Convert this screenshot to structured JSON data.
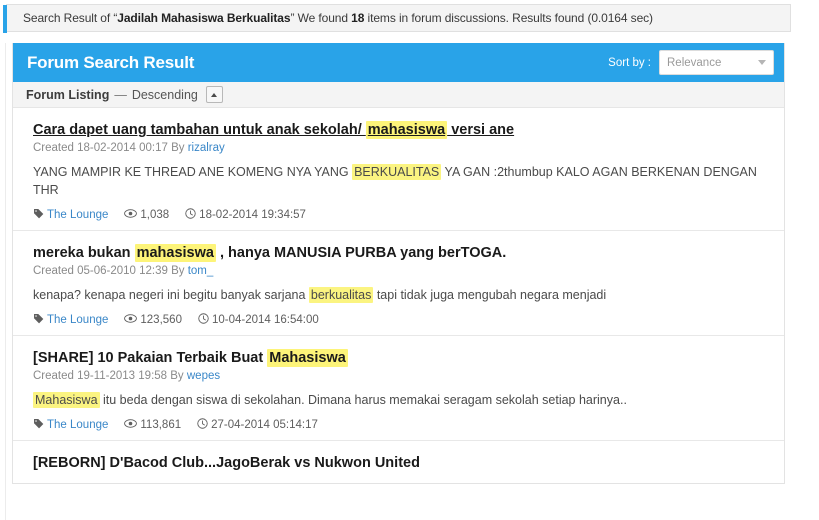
{
  "alert": {
    "prefix": "Search Result of “",
    "query": "Jadilah Mahasiswa Berkualitas",
    "mid": "” We found ",
    "count": "18",
    "suffix": " items in forum discussions. Results found (0.0164 sec)"
  },
  "panel": {
    "title": "Forum Search Result",
    "sort_label": "Sort by :",
    "sort_value": "Relevance",
    "sort_options": [
      "Relevance"
    ],
    "listing_label": "Forum Listing",
    "listing_dash": "—",
    "listing_order": "Descending",
    "collapse_icon": "chevron-up-icon"
  },
  "colors": {
    "accent_blue": "#29a3e8",
    "link_blue": "#3a87c8",
    "highlight_yellow": "#fbf481",
    "panel_bg": "#ffffff",
    "subheader_bg": "#f4f4f4"
  },
  "icons": {
    "tag": "tag-icon",
    "views": "eye-icon",
    "time": "clock-icon",
    "caret_down": "chevron-down-icon"
  },
  "results": [
    {
      "title_parts": [
        {
          "t": "Cara dapet uang tambahan untuk anak sekolah/ ",
          "hl": false
        },
        {
          "t": "mahasiswa",
          "hl": true
        },
        {
          "t": " versi ane",
          "hl": false
        }
      ],
      "title_plain": "Cara dapet uang tambahan untuk anak sekolah/ mahasiswa versi ane",
      "hovered": true,
      "created_prefix": "Created 18-02-2014 00:17 By ",
      "author": "rizalray",
      "snippet_parts": [
        {
          "t": "YANG MAMPIR KE THREAD ANE KOMENG NYA YANG ",
          "hl": false
        },
        {
          "t": "BERKUALITAS",
          "hl": true
        },
        {
          "t": " YA GAN :2thumbup KALO AGAN BERKENAN DENGAN THR",
          "hl": false
        }
      ],
      "forum": "The Lounge",
      "views": "1,038",
      "time": "18-02-2014 19:34:57"
    },
    {
      "title_parts": [
        {
          "t": "mereka bukan ",
          "hl": false
        },
        {
          "t": "mahasiswa",
          "hl": true
        },
        {
          "t": " , hanya MANUSIA PURBA yang berTOGA.",
          "hl": false
        }
      ],
      "title_plain": "mereka bukan mahasiswa , hanya MANUSIA PURBA yang berTOGA.",
      "hovered": false,
      "created_prefix": "Created 05-06-2010 12:39 By ",
      "author": "tom_",
      "snippet_parts": [
        {
          "t": "kenapa? kenapa negeri ini begitu banyak sarjana ",
          "hl": false
        },
        {
          "t": "berkualitas",
          "hl": true
        },
        {
          "t": " tapi tidak juga mengubah negara menjadi",
          "hl": false
        }
      ],
      "forum": "The Lounge",
      "views": "123,560",
      "time": "10-04-2014 16:54:00"
    },
    {
      "title_parts": [
        {
          "t": "[SHARE] 10 Pakaian Terbaik Buat ",
          "hl": false
        },
        {
          "t": "Mahasiswa",
          "hl": true
        }
      ],
      "title_plain": "[SHARE] 10 Pakaian Terbaik Buat Mahasiswa",
      "hovered": false,
      "created_prefix": "Created 19-11-2013 19:58 By ",
      "author": "wepes",
      "snippet_parts": [
        {
          "t": "Mahasiswa",
          "hl": true
        },
        {
          "t": " itu beda dengan siswa di sekolahan. Dimana harus memakai seragam sekolah setiap harinya..",
          "hl": false
        }
      ],
      "forum": "The Lounge",
      "views": "113,861",
      "time": "27-04-2014 05:14:17"
    },
    {
      "title_parts": [
        {
          "t": "[REBORN] D'Bacod Club...JagoBerak vs Nukwon United",
          "hl": false
        }
      ],
      "title_plain": "[REBORN] D'Bacod Club...JagoBerak vs Nukwon United",
      "hovered": false,
      "created_prefix": "",
      "author": "",
      "snippet_parts": [],
      "forum": "",
      "views": "",
      "time": "",
      "partial": true
    }
  ]
}
